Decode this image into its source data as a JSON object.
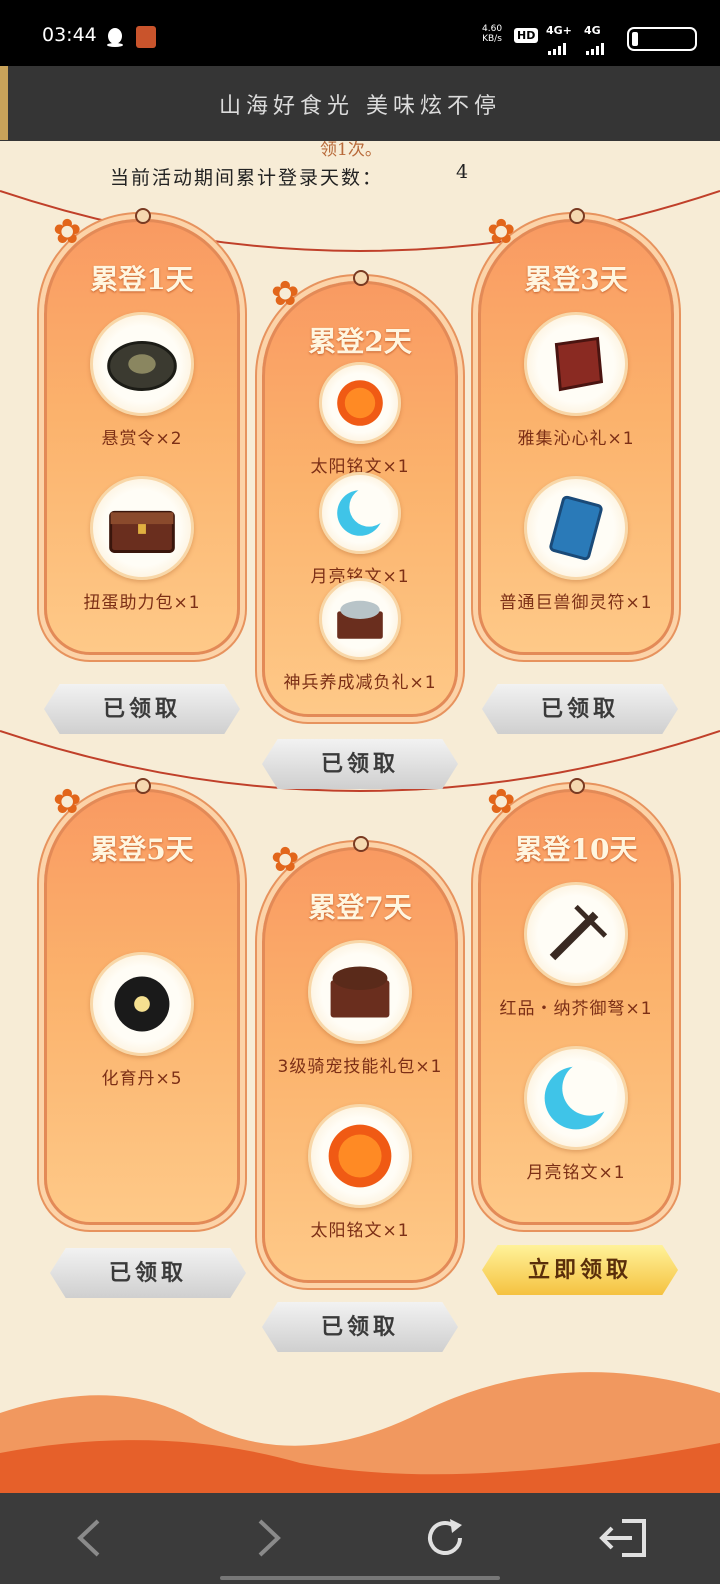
{
  "status": {
    "time": "03:44",
    "net_speed": "4.60",
    "net_unit": "KB/s",
    "hd": "HD",
    "sim1": "4G+",
    "sim2": "4G"
  },
  "header": {
    "title": "山海好食光 美味炫不停"
  },
  "intro": {
    "partial_text": "领1次。",
    "login_label": "当前活动期间累计登录天数：",
    "login_days": "4"
  },
  "cards": [
    {
      "title": "累登1天",
      "items": [
        {
          "label": "悬赏令×2",
          "icon": "token-icon"
        },
        {
          "label": "扭蛋助力包×1",
          "icon": "chest-icon"
        }
      ],
      "button": "已领取",
      "claimed": true
    },
    {
      "title": "累登2天",
      "items": [
        {
          "label": "太阳铭文×1",
          "icon": "sun-icon"
        },
        {
          "label": "月亮铭文×1",
          "icon": "moon-icon"
        },
        {
          "label": "神兵养成减负礼×1",
          "icon": "chest-icon"
        }
      ],
      "button": "已领取",
      "claimed": true
    },
    {
      "title": "累登3天",
      "items": [
        {
          "label": "雅集沁心礼×1",
          "icon": "gem-icon"
        },
        {
          "label": "普通巨兽御灵符×1",
          "icon": "book-icon"
        }
      ],
      "button": "已领取",
      "claimed": true
    },
    {
      "title": "累登5天",
      "items": [
        {
          "label": "化育丹×5",
          "icon": "orb-icon"
        }
      ],
      "button": "已领取",
      "claimed": true
    },
    {
      "title": "累登7天",
      "items": [
        {
          "label": "3级骑宠技能礼包×1",
          "icon": "chest-icon"
        },
        {
          "label": "太阳铭文×1",
          "icon": "sun-icon"
        }
      ],
      "button": "已领取",
      "claimed": true
    },
    {
      "title": "累登10天",
      "items": [
        {
          "label": "红品・纳芥御弩×1",
          "icon": "crossbow-icon"
        },
        {
          "label": "月亮铭文×1",
          "icon": "moon-icon"
        }
      ],
      "button": "立即领取",
      "claimed": false
    }
  ],
  "nav": {
    "back": "back-icon",
    "forward": "forward-icon",
    "refresh": "refresh-icon",
    "exit": "exit-icon"
  },
  "colors": {
    "card_top": "#f99a62",
    "card_bottom": "#fec988",
    "claimed_button": "#cfcfcf",
    "claim_button": "#f5c240"
  }
}
